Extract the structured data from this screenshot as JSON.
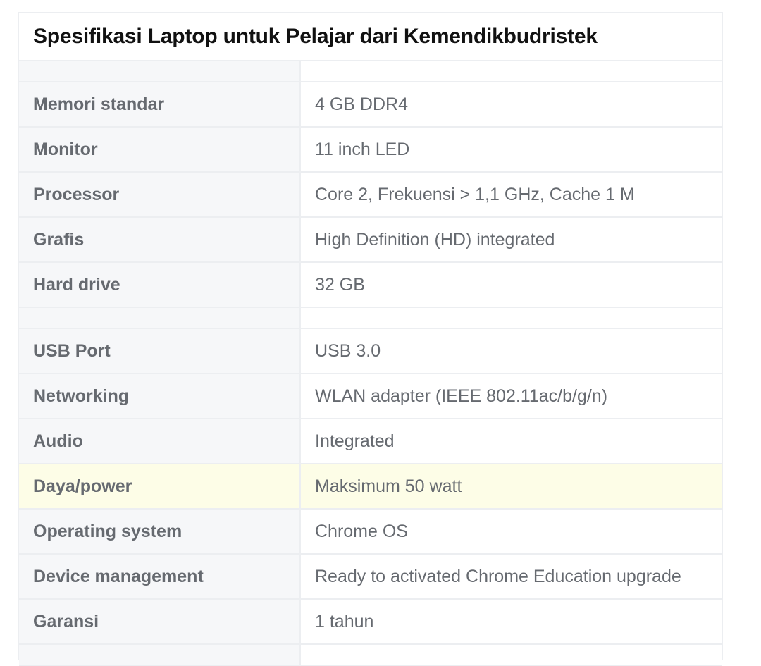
{
  "title": "Spesifikasi Laptop untuk Pelajar dari Kemendikbudristek",
  "rows": [
    {
      "label": "Memori standar",
      "value": "4 GB DDR4"
    },
    {
      "label": "Monitor",
      "value": "11 inch LED"
    },
    {
      "label": "Processor",
      "value": "Core 2, Frekuensi > 1,1 GHz, Cache 1 M"
    },
    {
      "label": "Grafis",
      "value": "High Definition (HD) integrated"
    },
    {
      "label": "Hard drive",
      "value": "32 GB"
    },
    {
      "label": "USB Port",
      "value": "USB 3.0"
    },
    {
      "label": "Networking",
      "value": "WLAN adapter (IEEE 802.11ac/b/g/n)"
    },
    {
      "label": "Audio",
      "value": "Integrated"
    },
    {
      "label": "Daya/power",
      "value": "Maksimum 50 watt"
    },
    {
      "label": "Operating system",
      "value": "Chrome OS"
    },
    {
      "label": "Device management",
      "value": "Ready to activated Chrome Education upgrade"
    },
    {
      "label": "Garansi",
      "value": "1 tahun"
    }
  ],
  "colors": {
    "highlight_row": "#fdfde7",
    "label_bg": "#f6f7f9",
    "text": "#666a70",
    "title": "#111111"
  }
}
